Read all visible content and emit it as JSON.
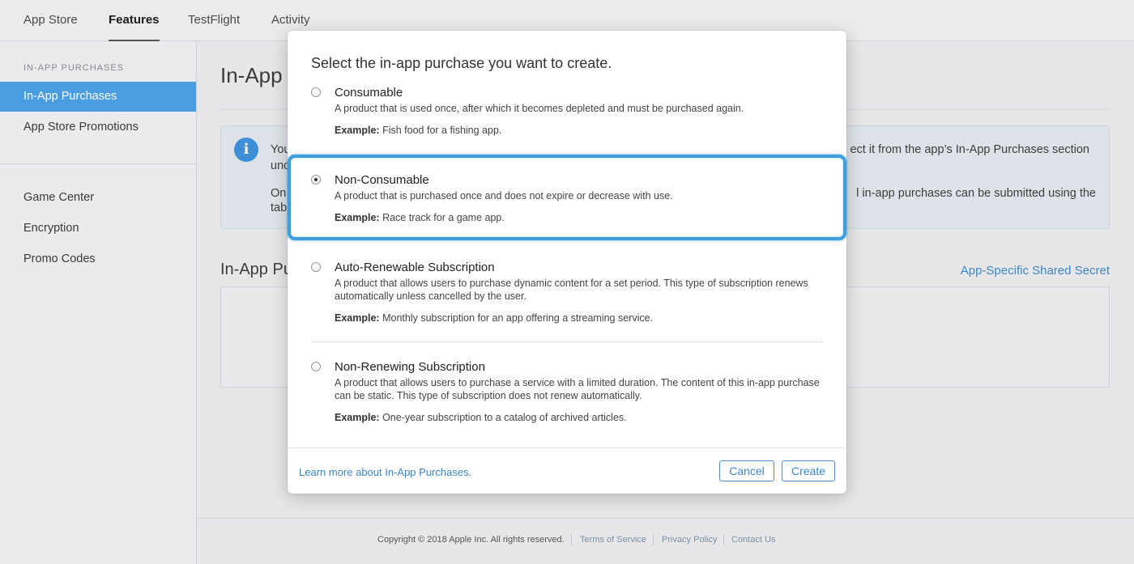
{
  "topnav": {
    "tabs": [
      {
        "label": "App Store"
      },
      {
        "label": "Features"
      },
      {
        "label": "TestFlight"
      },
      {
        "label": "Activity"
      }
    ]
  },
  "sidebar": {
    "section": "IN-APP PURCHASES",
    "items": [
      {
        "label": "In-App Purchases"
      },
      {
        "label": "App Store Promotions"
      },
      {
        "label": "Game Center"
      },
      {
        "label": "Encryption"
      },
      {
        "label": "Promo Codes"
      }
    ]
  },
  "main": {
    "title": "In-App",
    "info": {
      "left1": "You",
      "left2": "und",
      "left3": "On",
      "left4": "tab",
      "right1": "ect it from the app’s In-App Purchases section",
      "right2": "l in-app purchases can be submitted using the"
    },
    "section_title": "In-App Pu",
    "shared_secret": "App-Specific Shared Secret"
  },
  "footer": {
    "copyright": "Copyright © 2018 Apple Inc. All rights reserved.",
    "terms": "Terms of Service",
    "privacy": "Privacy Policy",
    "contact": "Contact Us"
  },
  "modal": {
    "title": "Select the in-app purchase you want to create.",
    "example_label": "Example:",
    "options": [
      {
        "name": "Consumable",
        "desc": "A product that is used once, after which it becomes depleted and must be purchased again.",
        "example": "Fish food for a fishing app.",
        "checked": false
      },
      {
        "name": "Non-Consumable",
        "desc": "A product that is purchased once and does not expire or decrease with use.",
        "example": "Race track for a game app.",
        "checked": true
      },
      {
        "name": "Auto-Renewable Subscription",
        "desc": "A product that allows users to purchase dynamic content for a set period. This type of subscription renews automatically unless cancelled by the user.",
        "example": "Monthly subscription for an app offering a streaming service.",
        "checked": false
      },
      {
        "name": "Non-Renewing Subscription",
        "desc": "A product that allows users to purchase a service with a limited duration. The content of this in-app purchase can be static. This type of subscription does not renew automatically.",
        "example": "One-year subscription to a catalog of archived articles.",
        "checked": false
      }
    ],
    "learn_more": "Learn more about In-App Purchases.",
    "cancel_label": "Cancel",
    "create_label": "Create"
  },
  "colors": {
    "accent": "#3c86c8",
    "sidebar_selected": "#4a9de0",
    "highlight": "#3e9ede"
  }
}
